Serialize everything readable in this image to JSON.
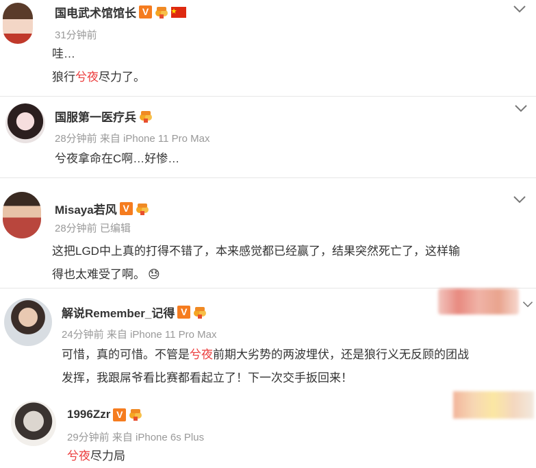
{
  "comments": [
    {
      "name": "国电武术馆馆长",
      "time": "31分钟前",
      "line1": "哇…",
      "line2_pre": "狼行",
      "line2_hl": "兮夜",
      "line2_post": "尽力了。"
    },
    {
      "name": "国服第一医疗兵",
      "time": "28分钟前 来自 iPhone 11 Pro Max",
      "text": "兮夜拿命在C啊…好惨…"
    },
    {
      "name": "Misaya若风",
      "time": "28分钟前  已编辑",
      "line1": "这把LGD中上真的打得不错了，本来感觉都已经赢了，结果突然死亡了，这样输",
      "line2": "得也太难受了啊。",
      "emoji": "😓"
    },
    {
      "name": "解说Remember_记得",
      "time": "24分钟前 来自 iPhone 11 Pro Max",
      "line1_pre": "可惜，真的可惜。不管是",
      "line1_hl": "兮夜",
      "line1_post": "前期大劣势的两波埋伏，还是狼行义无反顾的团战",
      "line2": "发挥，我跟屌爷看比赛都看起立了！下一次交手扳回来！"
    },
    {
      "name": "1996Zzr",
      "time": "29分钟前 来自 iPhone 6s Plus",
      "text_hl": "兮夜",
      "text_post": "尽力局"
    }
  ],
  "badges": {
    "verified": "V"
  },
  "icons": [
    "chevron-down-icon",
    "fan-badge-icon",
    "china-flag-icon"
  ],
  "colors": {
    "highlight": "#eb3b3b",
    "verified": "#f57c1f"
  }
}
